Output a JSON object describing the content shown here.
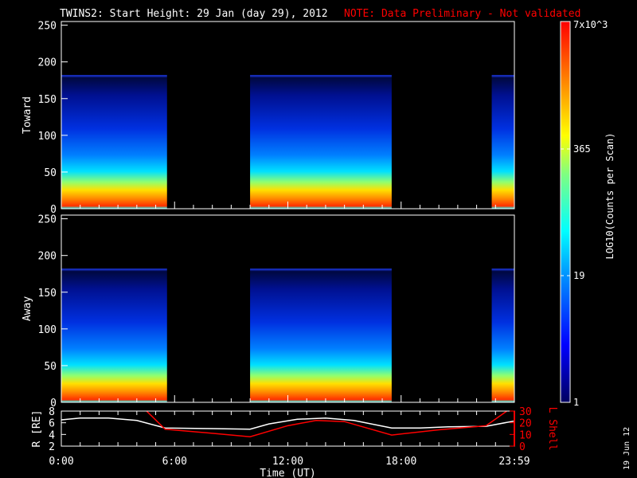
{
  "title": "TWINS2: Start Height: 29 Jan (day  29), 2012",
  "note": "NOTE: Data Preliminary - Not validated",
  "colors": {
    "note": "#ff0000",
    "lshell": "#ff0000",
    "r": "#ffffff"
  },
  "chart_data": [
    {
      "type": "heatmap",
      "ylabel": "Toward",
      "ylim": [
        0,
        255
      ],
      "yticks": [
        "0",
        "50",
        "100",
        "150",
        "200",
        "250"
      ],
      "data_intervals_hours": [
        [
          0,
          5.6
        ],
        [
          10.0,
          17.5
        ],
        [
          22.8,
          24.0
        ]
      ],
      "max_height": 182
    },
    {
      "type": "heatmap",
      "ylabel": "Away",
      "ylim": [
        0,
        255
      ],
      "yticks": [
        "0",
        "50",
        "100",
        "150",
        "200",
        "250"
      ],
      "data_intervals_hours": [
        [
          0,
          5.6
        ],
        [
          10.0,
          17.5
        ],
        [
          22.8,
          24.0
        ]
      ],
      "max_height": 182
    },
    {
      "type": "line",
      "ylabel": "R [RE]",
      "y2label": "L Shell",
      "ylim": [
        2,
        8
      ],
      "y2lim": [
        0,
        30
      ],
      "yticks": [
        "2",
        "4",
        "6",
        "8"
      ],
      "y2ticks": [
        "0",
        "10",
        "20",
        "30"
      ],
      "xlabel": "Time (UT)",
      "xticks": [
        "0:00",
        "6:00",
        "12:00",
        "18:00",
        "23:59"
      ],
      "series": [
        {
          "name": "R",
          "x": [
            0,
            1,
            2.5,
            4,
            5.5,
            8,
            10,
            11,
            12.5,
            14,
            15.5,
            17.5,
            19,
            20.5,
            22.5,
            24
          ],
          "y": [
            6.5,
            6.8,
            6.8,
            6.4,
            5.1,
            5.0,
            4.9,
            5.8,
            6.6,
            6.8,
            6.4,
            5.1,
            5.1,
            5.3,
            5.4,
            6.3
          ]
        },
        {
          "name": "L Shell",
          "axis": "y2",
          "x": [
            4.2,
            5.5,
            8,
            10,
            12,
            13.5,
            15,
            17.5,
            20,
            22.5,
            23.6
          ],
          "y": [
            35,
            14.5,
            11,
            8,
            17.5,
            22,
            21,
            9.5,
            14,
            17.5,
            30
          ]
        }
      ]
    }
  ],
  "colorbar": {
    "label": "LOG10(Counts per Scan)",
    "ticks": [
      "1",
      "19",
      "365",
      "7x10^3"
    ]
  },
  "footer_date": "19 Jun 12"
}
